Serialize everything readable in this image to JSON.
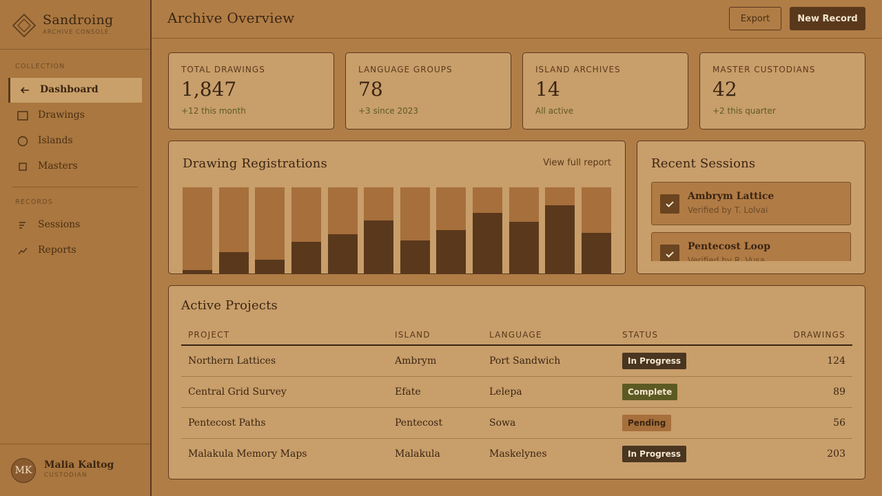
{
  "brand": {
    "name": "Sandroing",
    "subtitle": "ARCHIVE CONSOLE",
    "logo_icon": "diamond-icon"
  },
  "sidebar": {
    "sections": [
      {
        "label": "COLLECTION",
        "items": [
          {
            "label": "Dashboard",
            "icon": "arrow-left-icon",
            "active": true
          },
          {
            "label": "Drawings",
            "icon": "square-outline-icon",
            "active": false
          },
          {
            "label": "Islands",
            "icon": "circle-outline-icon",
            "active": false
          },
          {
            "label": "Masters",
            "icon": "small-square-icon",
            "active": false
          }
        ]
      },
      {
        "label": "RECORDS",
        "items": [
          {
            "label": "Sessions",
            "icon": "list-icon",
            "active": false
          },
          {
            "label": "Reports",
            "icon": "trend-icon",
            "active": false
          }
        ]
      }
    ]
  },
  "user": {
    "initials": "MK",
    "name": "Malia Kaltog",
    "role": "CUSTODIAN"
  },
  "header": {
    "title": "Archive Overview",
    "export_label": "Export",
    "new_label": "New Record"
  },
  "stats": [
    {
      "label": "TOTAL DRAWINGS",
      "value": "1,847",
      "note": "+12 this month"
    },
    {
      "label": "LANGUAGE GROUPS",
      "value": "78",
      "note": "+3 since 2023"
    },
    {
      "label": "ISLAND ARCHIVES",
      "value": "14",
      "note": "All active"
    },
    {
      "label": "MASTER CUSTODIANS",
      "value": "42",
      "note": "+2 this quarter"
    }
  ],
  "registrations": {
    "title": "Drawing Registrations",
    "link_label": "View full report",
    "chart_data": {
      "type": "bar",
      "values": [
        0.05,
        0.25,
        0.17,
        0.37,
        0.46,
        0.62,
        0.39,
        0.51,
        0.71,
        0.6,
        0.79,
        0.48
      ],
      "ylim": [
        0,
        1
      ]
    }
  },
  "sessions": {
    "title": "Recent Sessions",
    "items": [
      {
        "name": "Ambrym Lattice",
        "sub": "Verified by T. Lolvai"
      },
      {
        "name": "Pentecost Loop",
        "sub": "Verified by R. Vusa"
      }
    ]
  },
  "projects": {
    "title": "Active Projects",
    "columns": [
      "PROJECT",
      "ISLAND",
      "LANGUAGE",
      "STATUS",
      "DRAWINGS"
    ],
    "rows": [
      {
        "project": "Northern Lattices",
        "island": "Ambrym",
        "language": "Port Sandwich",
        "status": "In Progress",
        "drawings": "124"
      },
      {
        "project": "Central Grid Survey",
        "island": "Efate",
        "language": "Lelepa",
        "status": "Complete",
        "drawings": "89"
      },
      {
        "project": "Pentecost Paths",
        "island": "Pentecost",
        "language": "Sowa",
        "status": "Pending",
        "drawings": "56"
      },
      {
        "project": "Malakula Memory Maps",
        "island": "Malakula",
        "language": "Maskelynes",
        "status": "In Progress",
        "drawings": "203"
      }
    ],
    "status_colors": {
      "In Progress": {
        "bg": "#4a3520",
        "fg": "#f3e6cf"
      },
      "Complete": {
        "bg": "#5c5a22",
        "fg": "#f3e6cf"
      },
      "Pending": {
        "bg": "#a66f3b",
        "fg": "#3b2512"
      }
    }
  }
}
